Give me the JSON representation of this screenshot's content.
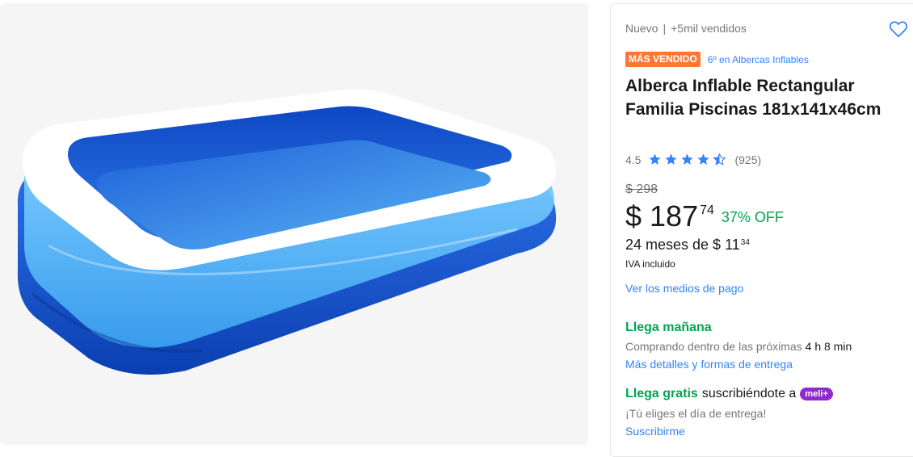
{
  "product": {
    "condition": "Nuevo",
    "separator": "|",
    "sold": "+5mil vendidos",
    "badge": "MÁS VENDIDO",
    "badge_color": "#ff7733",
    "rank": "6º en Albercas Inflables",
    "title": "Alberca Inflable Rectangular Familia Piscinas 181x141x46cm",
    "image_icon": "inflatable-pool-image",
    "favorite_icon": "heart-outline-icon"
  },
  "rating": {
    "value": "4.5",
    "stars": 4.5,
    "count": "(925)",
    "star_color": "#3483fa"
  },
  "price": {
    "original": "$ 298",
    "currency": "$",
    "amount": "187",
    "cents": "74",
    "discount": "37% OFF",
    "installments_text": "24 meses de $ 11",
    "installments_cents": "34",
    "tax_note": "IVA incluido",
    "payment_link": "Ver los medios de pago"
  },
  "shipping": {
    "primary": "Llega mañana",
    "primary_sub": "Comprando dentro de las próximas",
    "countdown": "4 h 8 min",
    "details_link": "Más detalles y formas de entrega",
    "free_label": "Llega gratis",
    "free_text": "suscribiéndote a",
    "meli_badge": "meli+",
    "choose_day": "¡Tú eliges el día de entrega!",
    "subscribe_link": "Suscribirme"
  },
  "colors": {
    "accent": "#3483fa",
    "green": "#00a650",
    "meli_plus": "#8f2bc9"
  }
}
